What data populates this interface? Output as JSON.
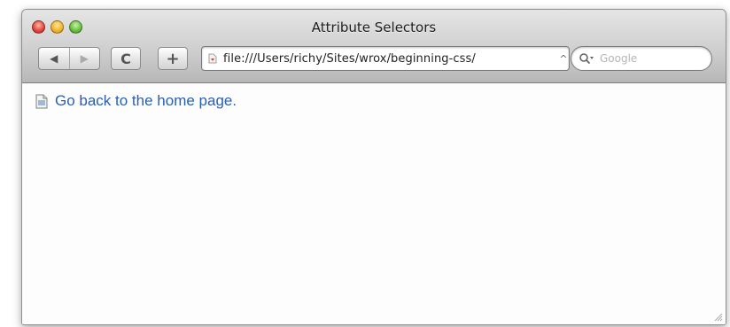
{
  "window": {
    "title": "Attribute Selectors"
  },
  "toolbar": {
    "back_icon": "back-arrow-icon",
    "forward_icon": "forward-arrow-icon",
    "reload_icon": "reload-icon",
    "add_icon": "add-bookmark-icon",
    "address": {
      "url": "file:///Users/richy/Sites/wrox/beginning-css/",
      "caret": "^"
    },
    "search": {
      "placeholder": "Google"
    }
  },
  "content": {
    "link_text": "Go back to the home page."
  },
  "colors": {
    "link": "#2a5fb0",
    "close_light": "#e0443a",
    "minimize_light": "#f0b329",
    "zoom_light": "#66bd3b"
  }
}
